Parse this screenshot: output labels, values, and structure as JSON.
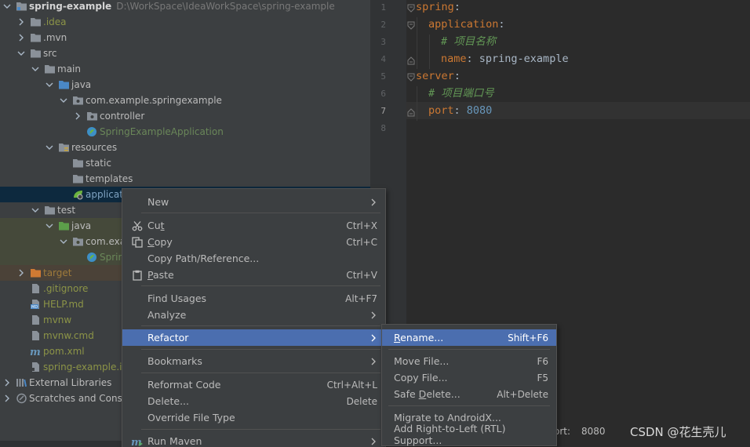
{
  "project_tree": {
    "root": {
      "name": "spring-example",
      "path": "D:\\WorkSpace\\IdeaWorkSpace\\spring-example"
    },
    "items": [
      {
        "label": ".idea",
        "type": "folder"
      },
      {
        "label": ".mvn",
        "type": "folder"
      },
      {
        "label": "src",
        "type": "folder"
      },
      {
        "label": "main",
        "type": "folder"
      },
      {
        "label": "java",
        "type": "source-folder"
      },
      {
        "label": "com.example.springexample",
        "type": "package"
      },
      {
        "label": "controller",
        "type": "package"
      },
      {
        "label": "SpringExampleApplication",
        "type": "spring-class"
      },
      {
        "label": "resources",
        "type": "resources-folder"
      },
      {
        "label": "static",
        "type": "folder"
      },
      {
        "label": "templates",
        "type": "folder"
      },
      {
        "label": "applicat",
        "type": "yaml-file"
      },
      {
        "label": "test",
        "type": "folder"
      },
      {
        "label": "java",
        "type": "test-folder"
      },
      {
        "label": "com.exa",
        "type": "package"
      },
      {
        "label": "Sprin",
        "type": "spring-class"
      },
      {
        "label": "target",
        "type": "excluded-folder"
      },
      {
        "label": ".gitignore",
        "type": "file"
      },
      {
        "label": "HELP.md",
        "type": "markdown"
      },
      {
        "label": "mvnw",
        "type": "file"
      },
      {
        "label": "mvnw.cmd",
        "type": "file"
      },
      {
        "label": "pom.xml",
        "type": "maven"
      },
      {
        "label": "spring-example.in",
        "type": "file"
      },
      {
        "label": "External Libraries",
        "type": "libraries"
      },
      {
        "label": "Scratches and Consc",
        "type": "scratches"
      }
    ]
  },
  "editor": {
    "line_numbers": [
      "1",
      "2",
      "3",
      "4",
      "5",
      "6",
      "7",
      "8"
    ],
    "active_line": "7",
    "lines": [
      {
        "key": "spring",
        "sep": ":",
        "value": ""
      },
      {
        "key": "application",
        "sep": ":",
        "value": ""
      },
      {
        "comment": "# 项目名称"
      },
      {
        "key": "name",
        "sep": ":",
        "value": " spring-example"
      },
      {
        "key": "server",
        "sep": ":",
        "value": ""
      },
      {
        "comment": "# 项目端口号"
      },
      {
        "key": "port",
        "sep": ":",
        "value": " 8080"
      },
      {}
    ]
  },
  "context_menu": {
    "items": [
      {
        "label": "New",
        "submenu": true
      },
      {
        "label": "Cut",
        "mnemonic": "t",
        "shortcut": "Ctrl+X",
        "icon": "scissors-icon"
      },
      {
        "label": "Copy",
        "mnemonic": "C",
        "shortcut": "Ctrl+C",
        "icon": "copy-icon"
      },
      {
        "label": "Copy Path/Reference..."
      },
      {
        "label": "Paste",
        "mnemonic": "P",
        "shortcut": "Ctrl+V",
        "icon": "paste-icon"
      },
      {
        "label": "Find Usages",
        "shortcut": "Alt+F7"
      },
      {
        "label": "Analyze",
        "submenu": true
      },
      {
        "label": "Refactor",
        "submenu": true,
        "highlighted": true
      },
      {
        "label": "Bookmarks",
        "submenu": true
      },
      {
        "label": "Reformat Code",
        "shortcut": "Ctrl+Alt+L"
      },
      {
        "label": "Delete...",
        "shortcut": "Delete"
      },
      {
        "label": "Override File Type"
      },
      {
        "label": "Run Maven",
        "submenu": true,
        "icon": "maven-icon"
      }
    ]
  },
  "refactor_submenu": {
    "items": [
      {
        "label": "Rename...",
        "shortcut": "Shift+F6",
        "highlighted": true
      },
      {
        "label": "Move File...",
        "shortcut": "F6"
      },
      {
        "label": "Copy File...",
        "shortcut": "F5"
      },
      {
        "label": "Safe Delete...",
        "shortcut": "Alt+Delete"
      },
      {
        "label": "Migrate to AndroidX..."
      },
      {
        "label": "Add Right-to-Left (RTL) Support..."
      }
    ]
  },
  "status_bar": {
    "key": "ort:",
    "value": "8080"
  },
  "watermark": "CSDN @花生壳儿",
  "colors": {
    "selection": "#4b6eaf",
    "yaml_key": "#cc7832",
    "comment": "#629755",
    "number": "#6897bb"
  }
}
